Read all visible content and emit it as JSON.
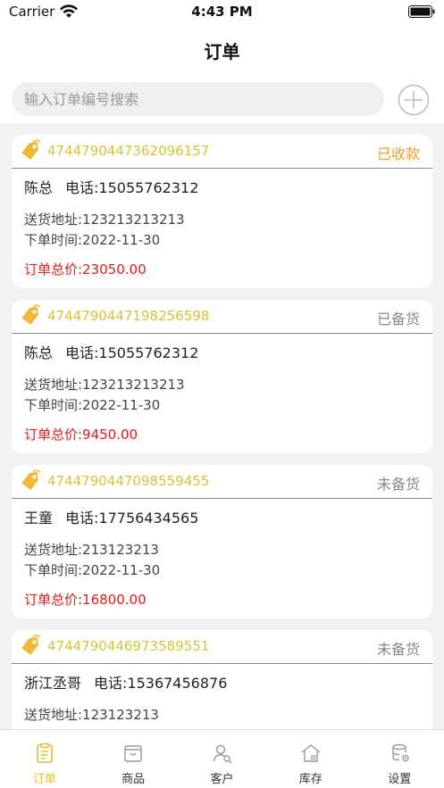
{
  "status_bar": {
    "carrier": "Carrier",
    "time": "4:43 PM",
    "icons": [
      "wifi-icon",
      "battery-icon"
    ]
  },
  "nav": {
    "title": "订单"
  },
  "search": {
    "placeholder": "输入订单编号搜索",
    "value": "",
    "add_icon": "plus-circle-icon"
  },
  "colors": {
    "accent": "#e0bf33",
    "order_no": "#d8c23a",
    "status_paid": "#f0a030",
    "status_other": "#888888",
    "total": "#e01b1b"
  },
  "orders": [
    {
      "order_no": "4744790447362096157",
      "status": "已收款",
      "status_color": "#f0a030",
      "name": "陈总",
      "phone": "电话:15055762312",
      "address": "送货地址:123213213213",
      "time": "下单时间:2022-11-30",
      "total": "订单总价:23050.00"
    },
    {
      "order_no": "4744790447198256598",
      "status": "已备货",
      "status_color": "#888888",
      "name": "陈总",
      "phone": "电话:15055762312",
      "address": "送货地址:123213213213",
      "time": "下单时间:2022-11-30",
      "total": "订单总价:9450.00"
    },
    {
      "order_no": "4744790447098559455",
      "status": "未备货",
      "status_color": "#888888",
      "name": "王童",
      "phone": "电话:17756434565",
      "address": "送货地址:213123213",
      "time": "下单时间:2022-11-30",
      "total": "订单总价:16800.00"
    },
    {
      "order_no": "4744790446973589551",
      "status": "未备货",
      "status_color": "#888888",
      "name": "浙江丞哥",
      "phone": "电话:15367456876",
      "address": "送货地址:123123213",
      "time": "",
      "total": ""
    }
  ],
  "tabs": [
    {
      "label": "订单",
      "icon": "order-icon",
      "active": true
    },
    {
      "label": "商品",
      "icon": "goods-icon",
      "active": false
    },
    {
      "label": "客户",
      "icon": "customer-icon",
      "active": false
    },
    {
      "label": "库存",
      "icon": "warehouse-icon",
      "active": false
    },
    {
      "label": "设置",
      "icon": "settings-icon",
      "active": false
    }
  ]
}
